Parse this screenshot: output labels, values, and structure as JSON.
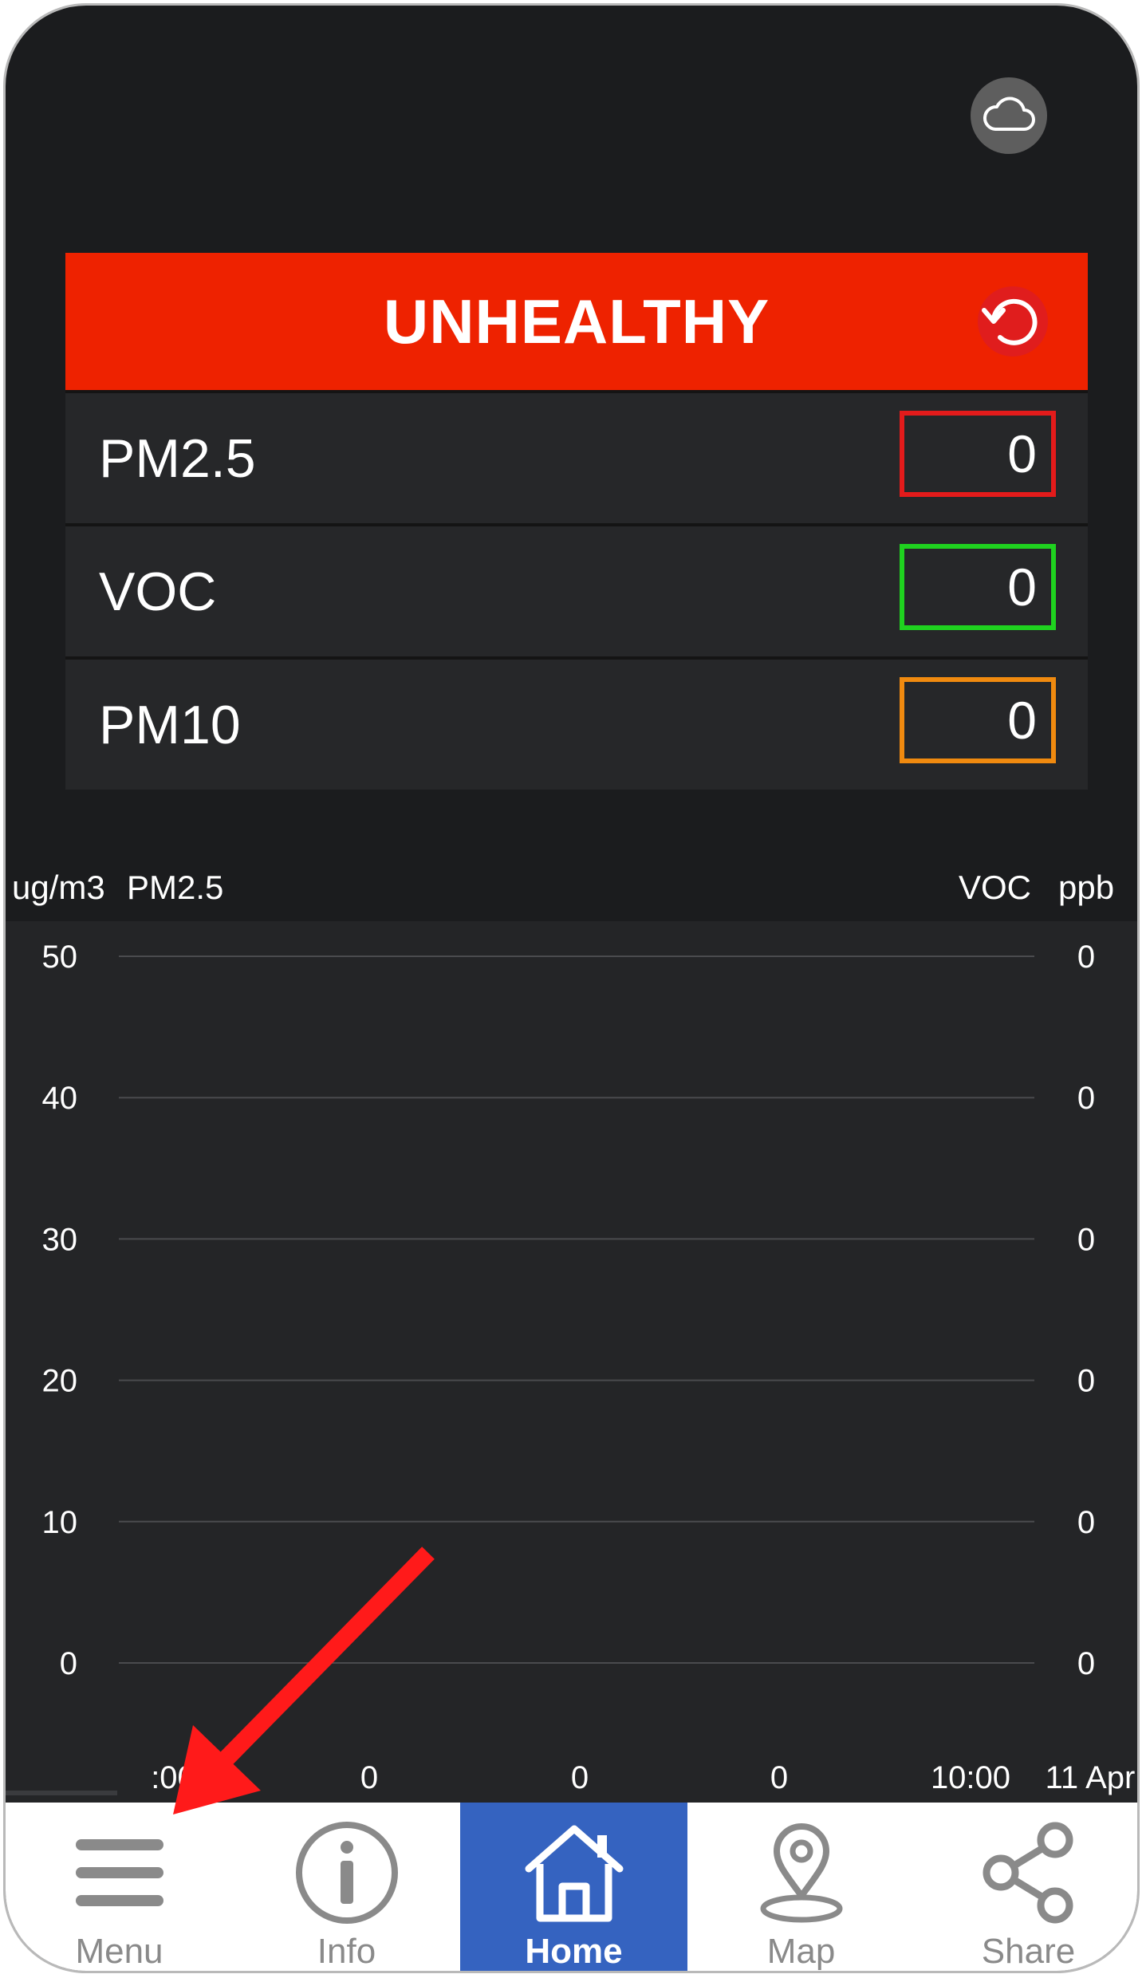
{
  "status": {
    "label": "UNHEALTHY",
    "color": "#ee2200"
  },
  "metrics": [
    {
      "name": "PM2.5",
      "value": "0",
      "border_color": "#e31b1b"
    },
    {
      "name": "VOC",
      "value": "0",
      "border_color": "#1fd21f"
    },
    {
      "name": "PM10",
      "value": "0",
      "border_color": "#f08a0f"
    }
  ],
  "chart": {
    "left_unit": "ug/m3",
    "left_series": "PM2.5",
    "right_series": "VOC",
    "right_unit": "ppb",
    "left_ticks": [
      "50",
      "40",
      "30",
      "20",
      "10",
      "0"
    ],
    "right_ticks": [
      "0",
      "0",
      "0",
      "0",
      "0",
      "0"
    ],
    "x_ticks": [
      ":00",
      "0",
      "0",
      "0",
      "10:00",
      "11 Apr"
    ]
  },
  "chart_data": {
    "type": "line",
    "ylim": [
      0,
      50
    ],
    "y_ticks": [
      50,
      40,
      30,
      20,
      10,
      0
    ],
    "y2_ticks": [
      0,
      0,
      0,
      0,
      0,
      0
    ],
    "x_tick_labels": [
      ":00",
      "0",
      "0",
      "0",
      "10:00",
      "11 Apr"
    ],
    "series": [],
    "ylabel": "ug/m3",
    "y2label": "ppb",
    "grid": true
  },
  "tabs": [
    {
      "label": "Menu",
      "icon": "menu-icon",
      "active": false
    },
    {
      "label": "Info",
      "icon": "info-icon",
      "active": false
    },
    {
      "label": "Home",
      "icon": "home-icon",
      "active": true
    },
    {
      "label": "Map",
      "icon": "map-pin-icon",
      "active": false
    },
    {
      "label": "Share",
      "icon": "share-icon",
      "active": false
    }
  ],
  "colors": {
    "background": "#1b1c1e",
    "chart_background": "#242527",
    "tab_active": "#3563c0",
    "annotation_arrow": "#ff1a1a"
  }
}
